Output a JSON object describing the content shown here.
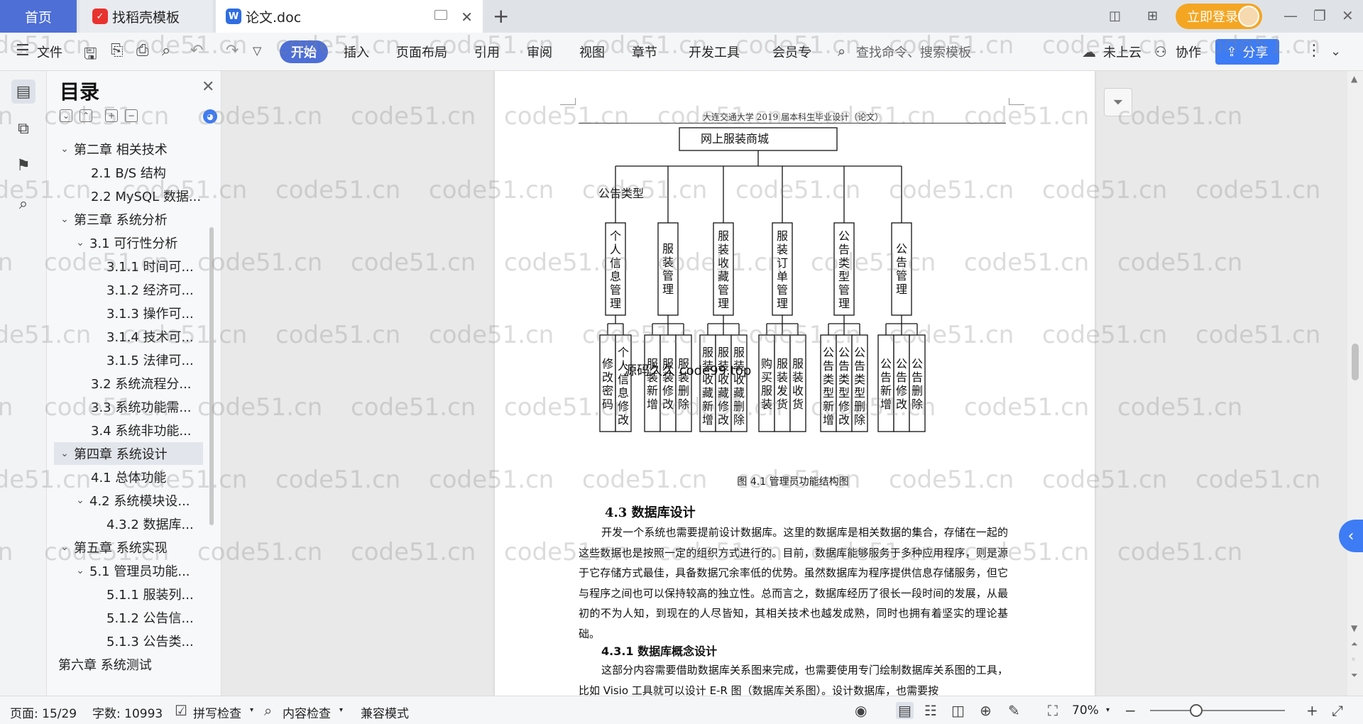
{
  "tabs": {
    "home": "首页",
    "template": "找稻壳模板",
    "document": "论文.doc",
    "add": "+"
  },
  "topbar": {
    "login": "立即登录"
  },
  "ribbon": {
    "file": "文件",
    "tabs": [
      "开始",
      "插入",
      "页面布局",
      "引用",
      "审阅",
      "视图",
      "章节",
      "开发工具",
      "会员专"
    ],
    "search_placeholder": "查找命令、搜索模板",
    "cloud": "未上云",
    "collab": "协作",
    "share": "分享"
  },
  "toc": {
    "title": "目录",
    "items": [
      {
        "label": "第二章  相关技术",
        "level": 1,
        "arrow": true
      },
      {
        "label": "2.1 B/S 结构",
        "level": 2
      },
      {
        "label": "2.2 MySQL 数据...",
        "level": 2
      },
      {
        "label": "第三章  系统分析",
        "level": 1,
        "arrow": true
      },
      {
        "label": "3.1 可行性分析",
        "level": 2,
        "arrow": true
      },
      {
        "label": "3.1.1 时间可...",
        "level": 3
      },
      {
        "label": "3.1.2 经济可...",
        "level": 3
      },
      {
        "label": "3.1.3 操作可...",
        "level": 3
      },
      {
        "label": "3.1.4 技术可...",
        "level": 3
      },
      {
        "label": "3.1.5 法律可...",
        "level": 3
      },
      {
        "label": "3.2 系统流程分...",
        "level": 2
      },
      {
        "label": "3.3 系统功能需...",
        "level": 2
      },
      {
        "label": "3.4  系统非功能...",
        "level": 2
      },
      {
        "label": "第四章  系统设计",
        "level": 1,
        "arrow": true,
        "active": true
      },
      {
        "label": "4.1 总体功能",
        "level": 2
      },
      {
        "label": "4.2  系统模块设...",
        "level": 2,
        "arrow": true
      },
      {
        "label": "4.3.2 数据库...",
        "level": 3
      },
      {
        "label": "第五章  系统实现",
        "level": 1,
        "arrow": true
      },
      {
        "label": "5.1  管理员功能...",
        "level": 2,
        "arrow": true
      },
      {
        "label": "5.1.1  服装列...",
        "level": 3
      },
      {
        "label": "5.1.2  公告信...",
        "level": 3
      },
      {
        "label": "5.1.3  公告类...",
        "level": 3
      },
      {
        "label": "第六章  系统测试",
        "level": 1
      }
    ]
  },
  "document": {
    "header": "大连交通大学 2019 届本科生毕业设计（论文）",
    "diagram": {
      "root": "网上服装商城",
      "side_label": "公告类型",
      "modules": [
        {
          "name": "个人信息管理",
          "children": [
            "修改密码",
            "个人信息修改"
          ]
        },
        {
          "name": "服装管理",
          "children": [
            "服装新增",
            "服装修改",
            "服装删除"
          ]
        },
        {
          "name": "服装收藏管理",
          "children": [
            "服装收藏新增",
            "服装收藏修改",
            "服装收藏删除"
          ]
        },
        {
          "name": "服装订单管理",
          "children": [
            "购买服装",
            "服装发货",
            "服装收货"
          ]
        },
        {
          "name": "公告类型管理",
          "children": [
            "公告类型新增",
            "公告类型修改",
            "公告类型删除"
          ]
        },
        {
          "name": "公告管理",
          "children": [
            "公告新增",
            "公告修改",
            "公告删除"
          ]
        }
      ]
    },
    "overlay": "源码久久 code99.top",
    "figure_caption": "图 4.1  管理员功能结构图",
    "section_heading": "4.3  数据库设计",
    "paragraph1": "开发一个系统也需要提前设计数据库。这里的数据库是相关数据的集合，存储在一起的这些数据也是按照一定的组织方式进行的。目前，数据库能够服务于多种应用程序，则是源于它存储方式最佳，具备数据冗余率低的优势。虽然数据库为程序提供信息存储服务，但它与程序之间也可以保持较高的独立性。总而言之，数据库经历了很长一段时间的发展，从最初的不为人知，到现在的人尽皆知，其相关技术也越发成熟，同时也拥有着坚实的理论基础。",
    "subsection_heading": "4.3.1  数据库概念设计",
    "paragraph2": "这部分内容需要借助数据库关系图来完成，也需要使用专门绘制数据库关系图的工具，比如 Visio 工具就可以设计 E-R 图（数据库关系图）。设计数据库，也需要按"
  },
  "watermark": "code51.cn",
  "status": {
    "page": "页面: 15/29",
    "words": "字数: 10993",
    "spell": "拼写检查",
    "content": "内容检查",
    "compat": "兼容模式",
    "zoom": "70%"
  },
  "colors": {
    "accent": "#4d6fd6",
    "share": "#3d7cf5",
    "login": "#f4a623"
  }
}
